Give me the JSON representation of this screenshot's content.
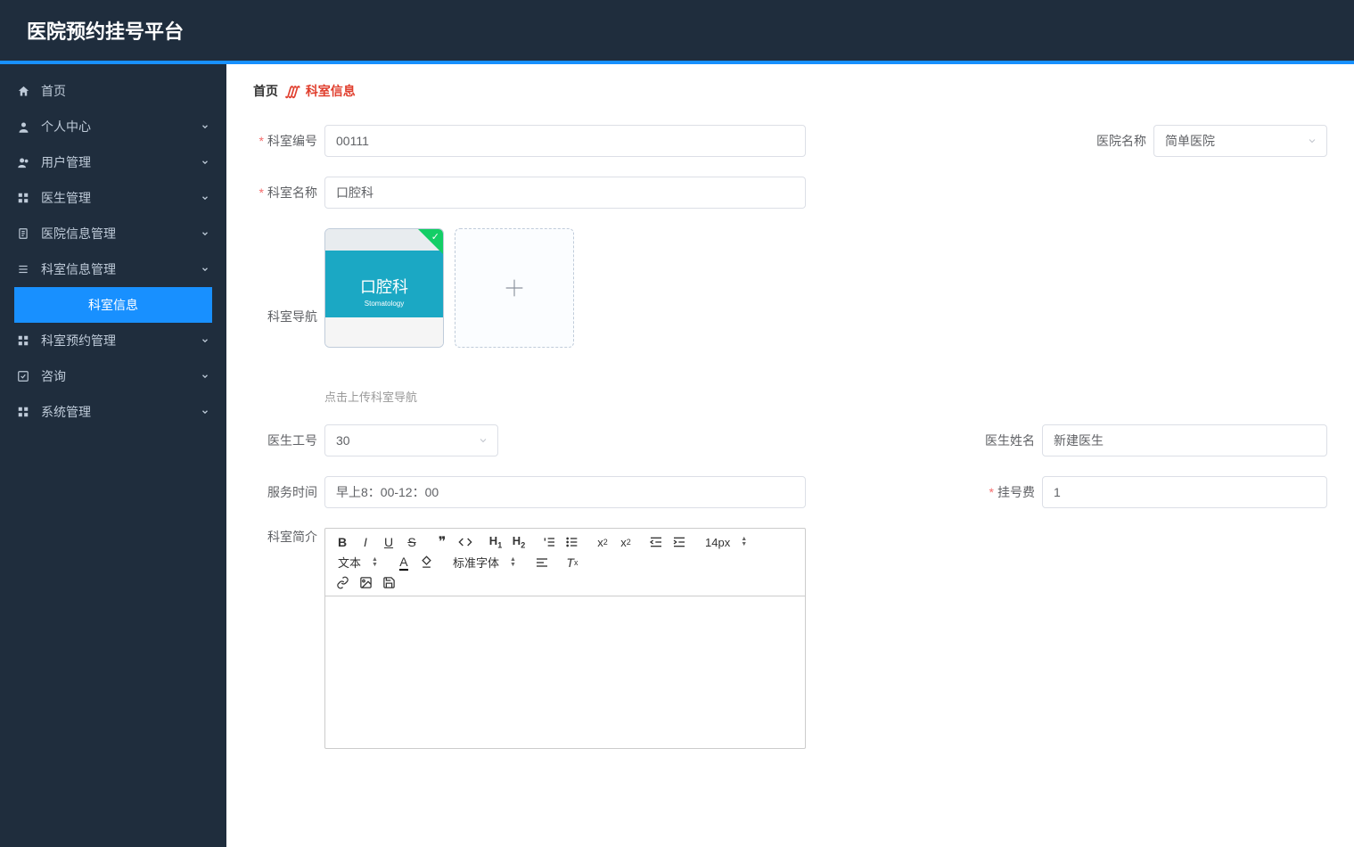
{
  "header": {
    "title": "医院预约挂号平台"
  },
  "sidebar": {
    "items": [
      {
        "label": "首页",
        "icon": "home"
      },
      {
        "label": "个人中心",
        "icon": "user",
        "expandable": true
      },
      {
        "label": "用户管理",
        "icon": "users",
        "expandable": true
      },
      {
        "label": "医生管理",
        "icon": "grid",
        "expandable": true
      },
      {
        "label": "医院信息管理",
        "icon": "clipboard",
        "expandable": true
      },
      {
        "label": "科室信息管理",
        "icon": "list",
        "expandable": true,
        "expanded": true
      },
      {
        "label": "科室预约管理",
        "icon": "grid",
        "expandable": true
      },
      {
        "label": "咨询",
        "icon": "check",
        "expandable": true
      },
      {
        "label": "系统管理",
        "icon": "grid",
        "expandable": true
      }
    ],
    "submenu_active": "科室信息"
  },
  "breadcrumb": {
    "home": "首页",
    "current": "科室信息"
  },
  "form": {
    "dept_code": {
      "label": "科室编号",
      "value": "00111"
    },
    "hospital_name": {
      "label": "医院名称",
      "value": "简单医院"
    },
    "dept_name": {
      "label": "科室名称",
      "value": "口腔科"
    },
    "dept_nav": {
      "label": "科室导航",
      "tip": "点击上传科室导航",
      "thumb_cn": "口腔科",
      "thumb_en": "Stomatology"
    },
    "doctor_id": {
      "label": "医生工号",
      "value": "30"
    },
    "doctor_name": {
      "label": "医生姓名",
      "value": "新建医生"
    },
    "service_time": {
      "label": "服务时间",
      "value": "早上8：00-12：00"
    },
    "reg_fee": {
      "label": "挂号费",
      "value": "1"
    },
    "dept_intro": {
      "label": "科室简介"
    }
  },
  "editor": {
    "font_size": "14px",
    "text_label": "文本",
    "font_family": "标准字体"
  }
}
